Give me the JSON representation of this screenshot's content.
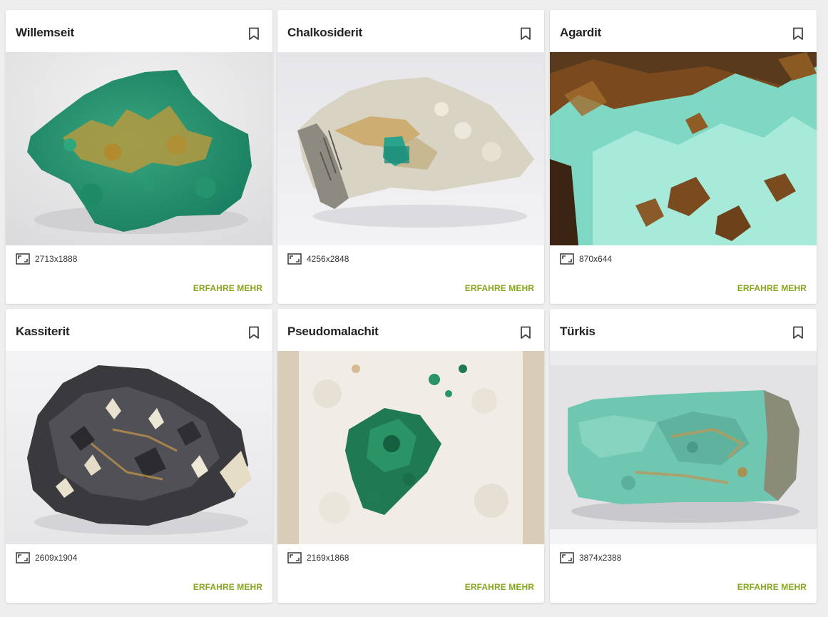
{
  "cards": [
    {
      "title": "Willemseit",
      "dimensions": "2713x1888",
      "link_label": "ERFAHRE MEHR",
      "bookmark_icon": "bookmark-icon",
      "dimension_icon": "image-size-icon"
    },
    {
      "title": "Chalkosiderit",
      "dimensions": "4256x2848",
      "link_label": "ERFAHRE MEHR",
      "bookmark_icon": "bookmark-icon",
      "dimension_icon": "image-size-icon"
    },
    {
      "title": "Agardit",
      "dimensions": "870x644",
      "link_label": "ERFAHRE MEHR",
      "bookmark_icon": "bookmark-icon",
      "dimension_icon": "image-size-icon"
    },
    {
      "title": "Kassiterit",
      "dimensions": "2609x1904",
      "link_label": "ERFAHRE MEHR",
      "bookmark_icon": "bookmark-icon",
      "dimension_icon": "image-size-icon"
    },
    {
      "title": "Pseudomalachit",
      "dimensions": "2169x1868",
      "link_label": "ERFAHRE MEHR",
      "bookmark_icon": "bookmark-icon",
      "dimension_icon": "image-size-icon"
    },
    {
      "title": "Türkis",
      "dimensions": "3874x2388",
      "link_label": "ERFAHRE MEHR",
      "bookmark_icon": "bookmark-icon",
      "dimension_icon": "image-size-icon"
    }
  ],
  "colors": {
    "accent": "#86a71d",
    "background": "#eeeeee",
    "card": "#ffffff"
  }
}
